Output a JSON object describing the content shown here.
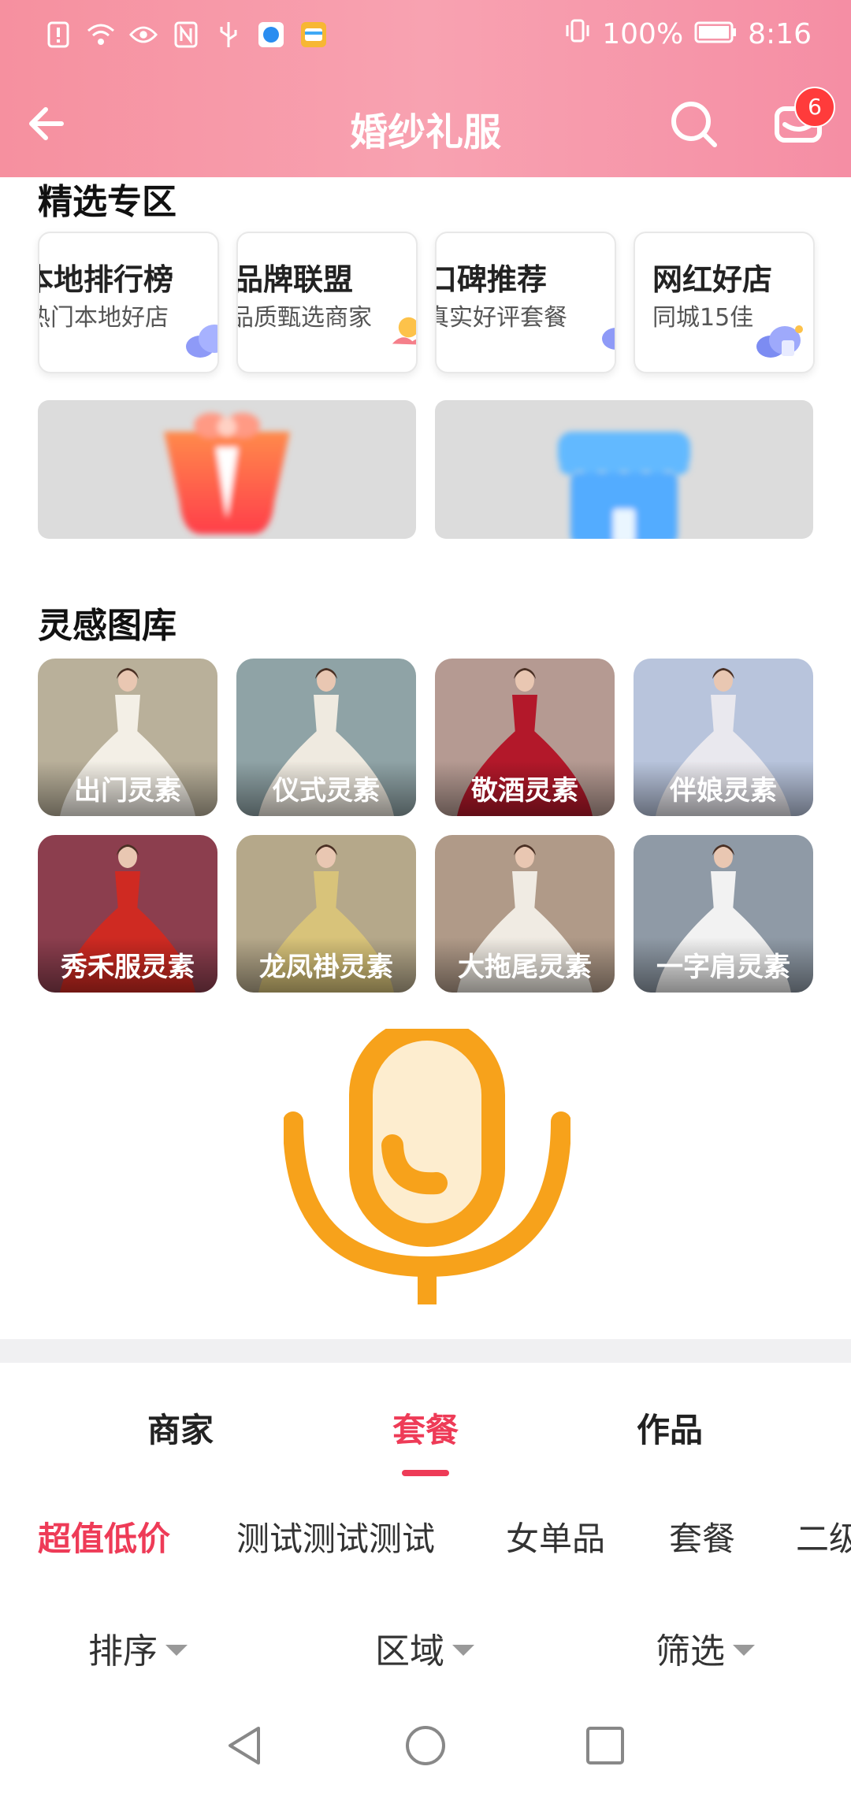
{
  "status_bar": {
    "battery": "100%",
    "time": "8:16"
  },
  "navbar": {
    "title": "婚纱礼服",
    "message_badge": "6",
    "back_icon": "arrow-left-icon",
    "search_icon": "search-icon",
    "mail_icon": "mail-icon"
  },
  "featured": {
    "title": "精选专区",
    "cards": [
      {
        "title": "本地排行榜",
        "subtitle": "热门本地好店"
      },
      {
        "title": "品牌联盟",
        "subtitle": "品质甄选商家"
      },
      {
        "title": "口碑推荐",
        "subtitle": "真实好评套餐"
      },
      {
        "title": "网红好店",
        "subtitle": "同城15佳"
      }
    ]
  },
  "inspiration": {
    "title": "灵感图库",
    "items": [
      {
        "label": "出门灵素",
        "bg": "#b9b09a",
        "dress": "#f3efe6"
      },
      {
        "label": "仪式灵素",
        "bg": "#8fa3a6",
        "dress": "#efeae0"
      },
      {
        "label": "敬酒灵素",
        "bg": "#b59a92",
        "dress": "#b3182a"
      },
      {
        "label": "伴娘灵素",
        "bg": "#b8c4dc",
        "dress": "#e9e8ee"
      },
      {
        "label": "秀禾服灵素",
        "bg": "#8c3e4e",
        "dress": "#cf2a22"
      },
      {
        "label": "龙凤褂灵素",
        "bg": "#b5a88a",
        "dress": "#d8c37a"
      },
      {
        "label": "大拖尾灵素",
        "bg": "#b09a88",
        "dress": "#f0ebe3"
      },
      {
        "label": "一字肩灵素",
        "bg": "#8f9aa6",
        "dress": "#f2f2f2"
      }
    ]
  },
  "tabs": [
    {
      "label": "商家",
      "active": false
    },
    {
      "label": "套餐",
      "active": true
    },
    {
      "label": "作品",
      "active": false
    }
  ],
  "subcategories": [
    {
      "label": "超值低价",
      "active": true
    },
    {
      "label": "测试测试测试",
      "active": false
    },
    {
      "label": "女单品",
      "active": false
    },
    {
      "label": "套餐",
      "active": false
    },
    {
      "label": "二级",
      "active": false
    }
  ],
  "filters": [
    {
      "label": "排序"
    },
    {
      "label": "区域"
    },
    {
      "label": "筛选"
    }
  ],
  "colors": {
    "accent": "#ee3b57",
    "header_pink": "#f6909f",
    "mic": "#f7a21b"
  }
}
